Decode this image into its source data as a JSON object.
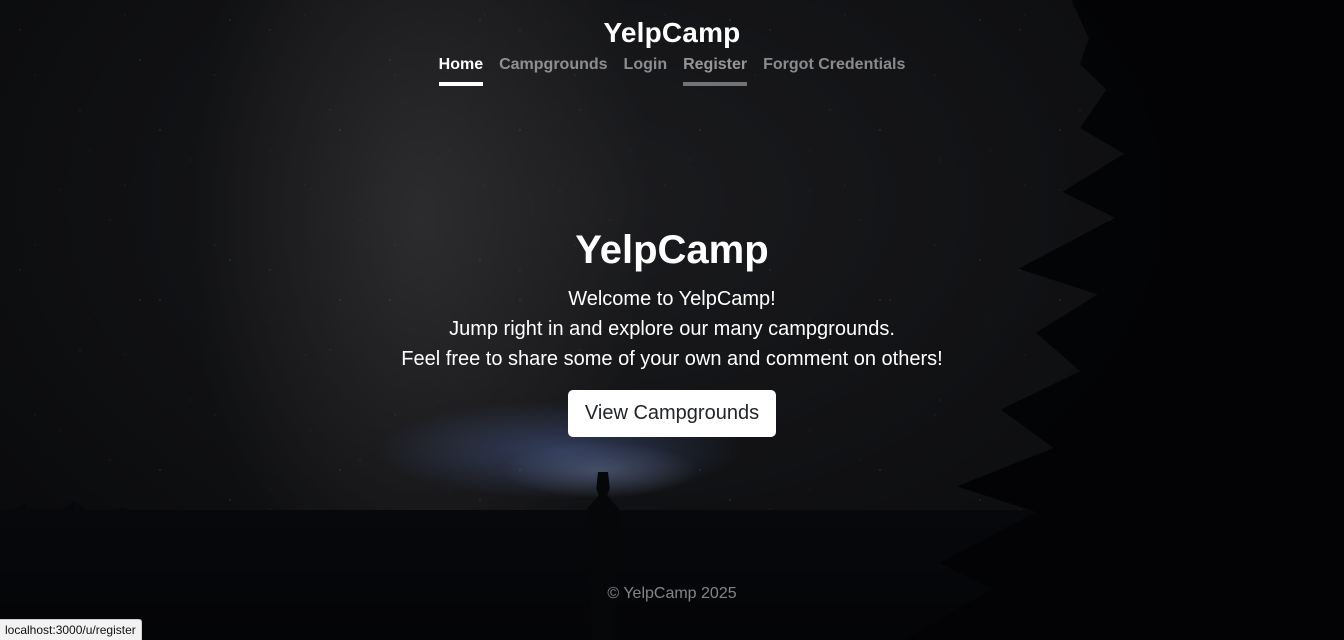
{
  "header": {
    "brand": "YelpCamp",
    "nav": [
      {
        "label": "Home",
        "state": "active"
      },
      {
        "label": "Campgrounds",
        "state": "normal"
      },
      {
        "label": "Login",
        "state": "normal"
      },
      {
        "label": "Register",
        "state": "hover"
      },
      {
        "label": "Forgot Credentials",
        "state": "normal"
      }
    ]
  },
  "hero": {
    "title": "YelpCamp",
    "lines": [
      "Welcome to YelpCamp!",
      "Jump right in and explore our many campgrounds.",
      "Feel free to share some of your own and comment on others!"
    ],
    "cta_label": "View Campgrounds"
  },
  "footer": {
    "text": "© YelpCamp 2025"
  },
  "status_bar": {
    "url": "localhost:3000/u/register"
  },
  "colors": {
    "text": "#ffffff",
    "muted_text": "#7f7f7f",
    "button_bg": "#ffffff",
    "button_text": "#212529"
  }
}
